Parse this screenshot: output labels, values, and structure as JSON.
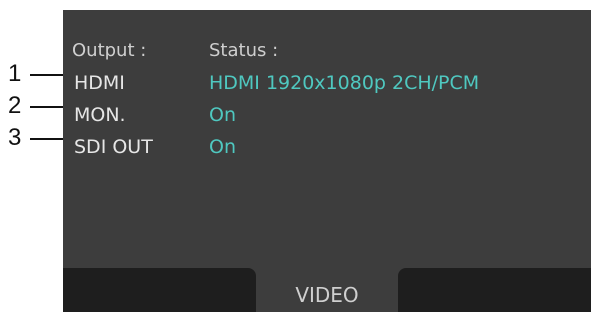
{
  "header": {
    "output_label": "Output :",
    "status_label": "Status :"
  },
  "rows": [
    {
      "callout": "1",
      "output": "HDMI",
      "status": "HDMI 1920x1080p 2CH/PCM"
    },
    {
      "callout": "2",
      "output": "MON.",
      "status": "On"
    },
    {
      "callout": "3",
      "output": "SDI OUT",
      "status": "On"
    }
  ],
  "footer": {
    "center_label": "VIDEO"
  },
  "colors": {
    "status_value": "#4fc8c0"
  }
}
